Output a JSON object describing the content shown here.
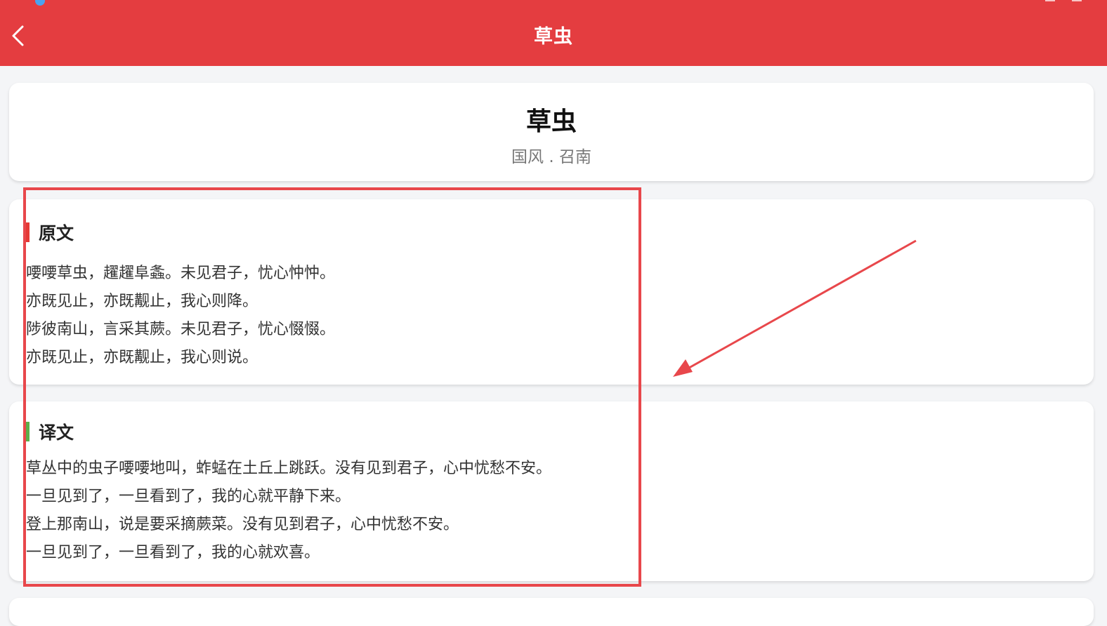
{
  "app_bar": {
    "title": "草虫",
    "back_icon": "chevron-left-icon",
    "color": "#e43d40"
  },
  "header_card": {
    "title": "草虫",
    "subtitle": "国风 . 召南"
  },
  "original": {
    "heading": "原文",
    "accent_color": "#e53935",
    "lines": [
      "喓喓草虫，趯趯阜螽。未见君子，忧心忡忡。",
      "亦既见止，亦既觏止，我心则降。",
      "陟彼南山，言采其蕨。未见君子，忧心惙惙。",
      "亦既见止，亦既觏止，我心则说。"
    ]
  },
  "translation": {
    "heading": "译文",
    "accent_color": "#5cae4a",
    "lines": [
      "草丛中的虫子喓喓地叫，蚱蜢在土丘上跳跃。没有见到君子，心中忧愁不安。",
      "一旦见到了，一旦看到了，我的心就平静下来。",
      "登上那南山，说是要采摘蕨菜。没有见到君子，心中忧愁不安。",
      "一旦见到了，一旦看到了，我的心就欢喜。"
    ]
  },
  "annotation": {
    "color": "#e8474b"
  }
}
